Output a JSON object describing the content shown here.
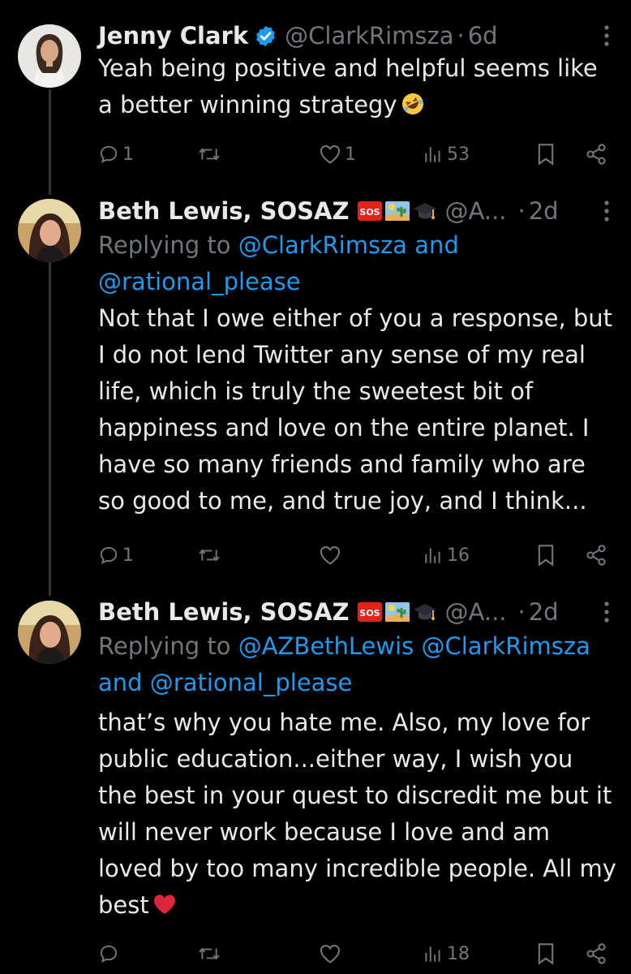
{
  "tweets": [
    {
      "name": "Jenny Clark",
      "verified": true,
      "handle": "@ClarkRimsza",
      "dot": "·",
      "time": "6d",
      "text": "Yeah being positive and helpful seems like a better winning strategy",
      "text_emoji": "rolling-on-floor-laughing-emoji",
      "stats": {
        "replies": "1",
        "reposts": "",
        "likes": "1",
        "views": "53"
      }
    },
    {
      "name": "Beth Lewis, SOSAZ",
      "verified": false,
      "badges": [
        "sos-emoji",
        "desert-emoji",
        "graduation-cap-emoji"
      ],
      "handle": "@A...",
      "dot": "·",
      "time": "2d",
      "replying_prefix": "Replying to ",
      "replying_mentions": "@ClarkRimsza and @rational_please",
      "text": "Not that I owe either of you a response, but I do not lend Twitter any sense of my real life, which is truly the sweetest bit of happiness and love on the entire planet. I have so many friends and family who are so good to me, and true joy, and I think...",
      "stats": {
        "replies": "1",
        "reposts": "",
        "likes": "",
        "views": "16"
      }
    },
    {
      "name": "Beth Lewis, SOSAZ",
      "verified": false,
      "badges": [
        "sos-emoji",
        "desert-emoji",
        "graduation-cap-emoji"
      ],
      "handle": "@A...",
      "dot": "·",
      "time": "2d",
      "replying_prefix": "Replying to ",
      "replying_mentions": "@AZBethLewis @ClarkRimsza and @rational_please",
      "text": "that’s why you hate me. Also, my love for public education...either way, I wish you the best in your quest to discredit me but it will never work because I love and am loved by too many incredible people. All my best",
      "text_emoji": "red-heart-emoji",
      "stats": {
        "replies": "",
        "reposts": "",
        "likes": "",
        "views": "18"
      }
    }
  ],
  "colors": {
    "background": "#000000",
    "text": "#e7e9ea",
    "muted": "#71767b",
    "link": "#1d9bf0",
    "thread_line": "#333639"
  }
}
